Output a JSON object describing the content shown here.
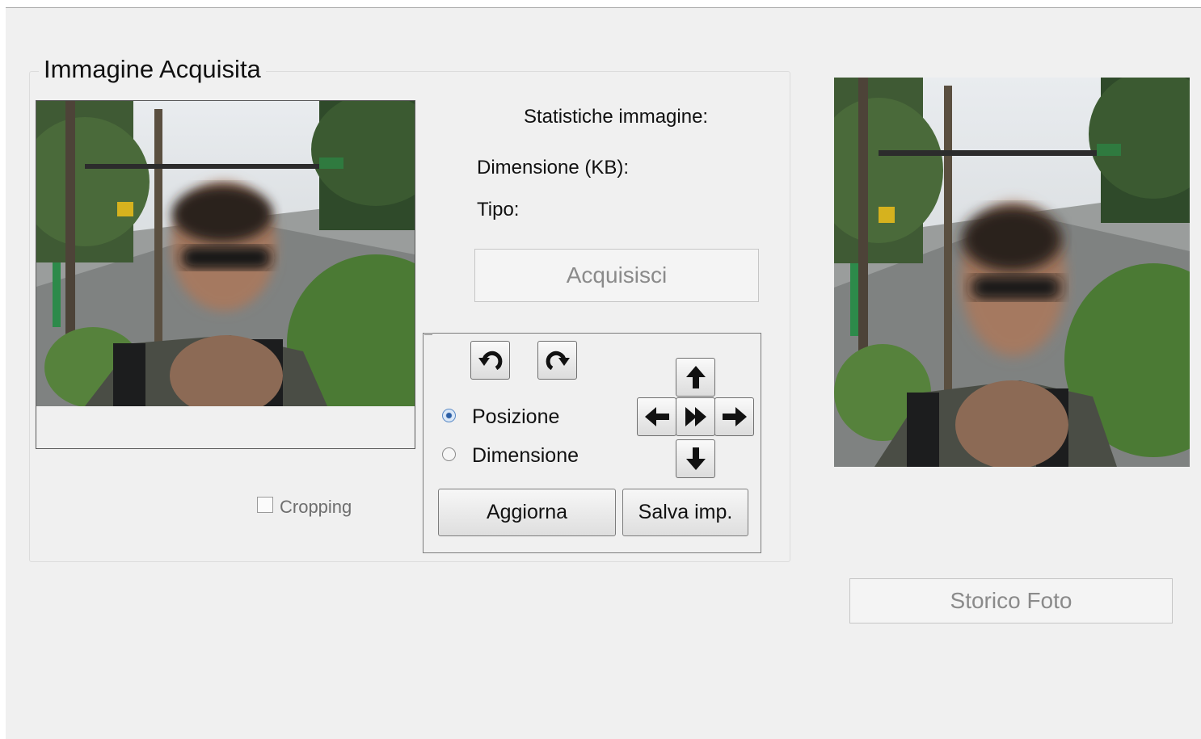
{
  "group": {
    "title": "Immagine Acquisita"
  },
  "stats": {
    "heading": "Statistiche immagine:",
    "size_label": "Dimensione (KB):",
    "type_label": "Tipo:"
  },
  "buttons": {
    "acquire": "Acquisisci",
    "update": "Aggiorna",
    "save_settings": "Salva imp.",
    "photo_history": "Storico Foto"
  },
  "mode": {
    "options": [
      {
        "label": "Posizione",
        "selected": true
      },
      {
        "label": "Dimensione",
        "selected": false
      }
    ]
  },
  "cropping": {
    "label": "Cropping",
    "checked": false,
    "enabled": false
  },
  "icons": {
    "rotate_left": "rotate-left-icon",
    "rotate_right": "rotate-right-icon",
    "up": "arrow-up-icon",
    "down": "arrow-down-icon",
    "left": "arrow-left-icon",
    "right": "arrow-right-icon",
    "center": "fast-forward-icon"
  }
}
